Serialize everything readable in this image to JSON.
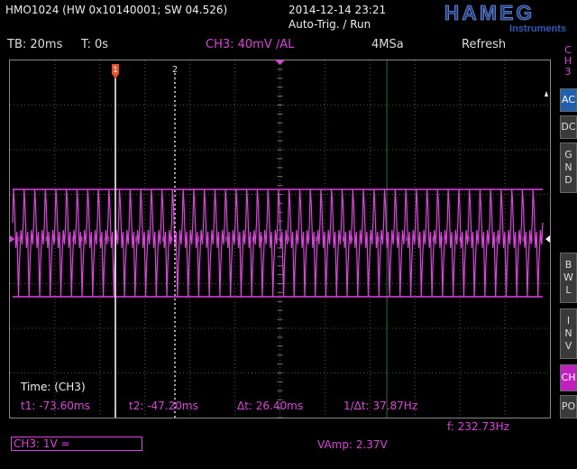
{
  "header": {
    "app_title": "HMO1024 (HW 0x10140001; SW 04.526)",
    "datetime": "2014-12-14 23:21",
    "trigger_mode": "Auto-Trig. / Run",
    "brand": "HAMEG",
    "brand_sub": "Instruments"
  },
  "status": {
    "timebase": "TB: 20ms",
    "time_offset": "T: 0s",
    "trigger": "CH3: 40mV ∕AL",
    "sample_rate": "4MSa",
    "refresh": "Refresh"
  },
  "side_panel": {
    "channel": "CH3",
    "buttons": [
      "AC",
      "DC",
      "GND",
      "BWL",
      "INV",
      "CH",
      "PO"
    ]
  },
  "cursors": {
    "c1_label": "1",
    "c2_label": "2",
    "ch_marker": "3"
  },
  "measurements": {
    "time_label": "Time: (CH3)",
    "t1": "t1: -73.60ms",
    "t2": "t2: -47.20ms",
    "dt": "Δt: 26.40ms",
    "inv_dt": "1/Δt: 37.87Hz"
  },
  "bottom": {
    "ch3_setting": "CH3: 1V ≈",
    "frequency": "f: 232.73Hz",
    "vamp": "VAmp: 2.37V"
  },
  "colors": {
    "trace": "#e040e0",
    "grid": "#555555",
    "cursor1": "#ffffff",
    "cursor_marker": "#e8502a"
  }
}
